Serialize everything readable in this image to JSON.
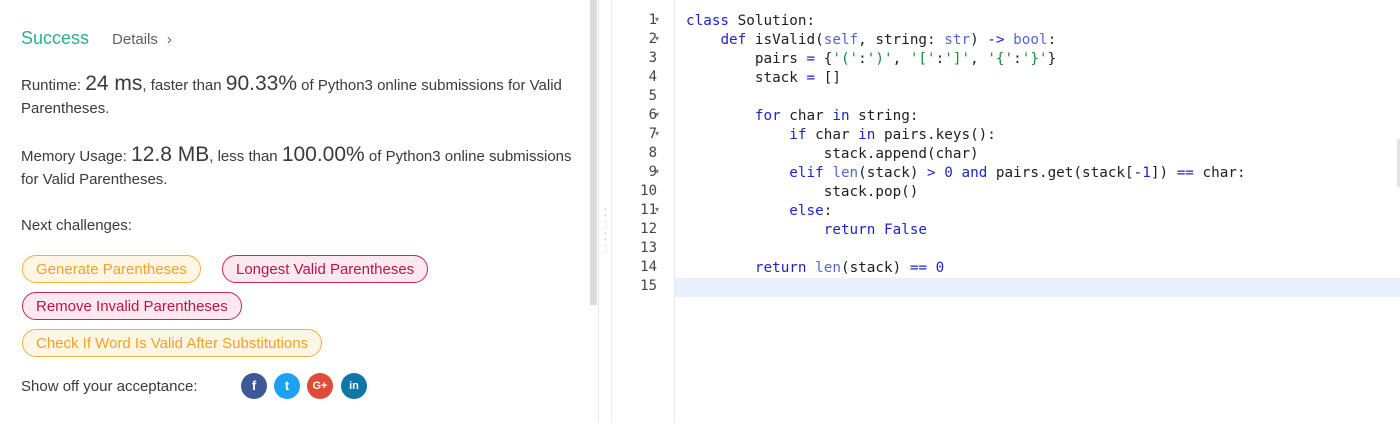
{
  "result": {
    "status": "Success",
    "details_label": "Details",
    "details_chevron": "›"
  },
  "runtime": {
    "label": "Runtime: ",
    "value": "24 ms",
    "mid": ", faster than ",
    "percent": "90.33%",
    "tail": " of Python3 online submissions for Valid Parentheses."
  },
  "memory": {
    "label": "Memory Usage: ",
    "value": "12.8 MB",
    "mid": ", less than ",
    "percent": "100.00%",
    "tail": " of Python3 online submissions for Valid Parentheses."
  },
  "next_challenges": {
    "label": "Next challenges:",
    "items": [
      {
        "label": "Generate Parentheses",
        "difficulty": "medium"
      },
      {
        "label": "Longest Valid Parentheses",
        "difficulty": "hard"
      },
      {
        "label": "Remove Invalid Parentheses",
        "difficulty": "hard"
      },
      {
        "label": "Check If Word Is Valid After Substitutions",
        "difficulty": "medium"
      }
    ]
  },
  "share": {
    "label": "Show off your acceptance:",
    "icons": [
      {
        "name": "facebook-icon",
        "glyph": "f",
        "color": "#3b5998"
      },
      {
        "name": "twitter-icon",
        "glyph": "t",
        "color": "#1da1f2"
      },
      {
        "name": "google-plus-icon",
        "glyph": "G+",
        "color": "#dd4b39"
      },
      {
        "name": "linkedin-icon",
        "glyph": "in",
        "color": "#0e76a8"
      }
    ]
  },
  "editor": {
    "line_numbers": [
      "1",
      "2",
      "3",
      "4",
      "5",
      "6",
      "7",
      "8",
      "9",
      "10",
      "11",
      "12",
      "13",
      "14",
      "15"
    ],
    "fold_lines": [
      1,
      2,
      6,
      7,
      9,
      11
    ],
    "fold_glyph": "▾",
    "code_lines": [
      "class Solution:",
      "    def isValid(self, string: str) -> bool:",
      "        pairs = {'(':')', '[':']', '{':'}'}",
      "        stack = []",
      "",
      "        for char in string:",
      "            if char in pairs.keys():",
      "                stack.append(char)",
      "            elif len(stack) > 0 and pairs.get(stack[-1]) == char:",
      "                stack.pop()",
      "            else:",
      "                return False",
      "",
      "        return len(stack) == 0",
      ""
    ]
  },
  "colors": {
    "success": "#2cae8f",
    "medium_tag": "#f0a325",
    "hard_tag": "#b8154f",
    "keyword": "#1e24c8",
    "string": "#198a3b",
    "active_line": "#e8f0fd"
  }
}
